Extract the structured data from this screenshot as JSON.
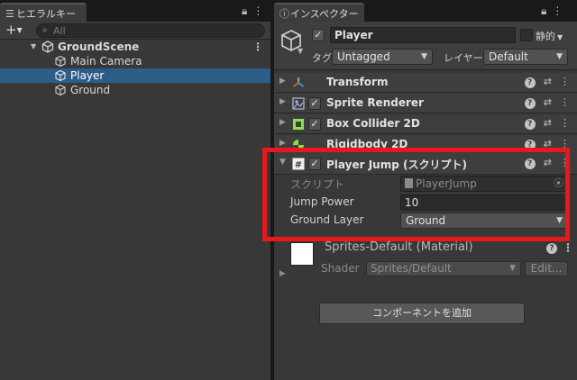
{
  "hierarchy": {
    "tab_label": "ヒエラルキー",
    "search_placeholder": "All",
    "add_button": "+",
    "scene_name": "GroundScene",
    "items": [
      {
        "label": "Main Camera"
      },
      {
        "label": "Player",
        "selected": true
      },
      {
        "label": "Ground"
      }
    ]
  },
  "inspector": {
    "tab_label": "インスペクター",
    "object_name": "Player",
    "active": true,
    "static_label": "静的",
    "tag_label": "タグ",
    "tag_value": "Untagged",
    "layer_label": "レイヤー",
    "layer_value": "Default",
    "components": [
      {
        "name": "Transform",
        "has_checkbox": false,
        "icon": "transform-icon"
      },
      {
        "name": "Sprite Renderer",
        "has_checkbox": true,
        "icon": "sprite-renderer-icon"
      },
      {
        "name": "Box Collider 2D",
        "has_checkbox": true,
        "icon": "box-collider-icon"
      },
      {
        "name": "Rigidbody 2D",
        "has_checkbox": false,
        "icon": "rigidbody-icon"
      },
      {
        "name": "Player Jump (スクリプト)",
        "has_checkbox": true,
        "icon": "script-icon"
      }
    ],
    "player_jump": {
      "script_label": "スクリプト",
      "script_value": "PlayerJump",
      "jump_power_label": "Jump Power",
      "jump_power_value": "10",
      "ground_layer_label": "Ground Layer",
      "ground_layer_value": "Ground"
    },
    "material": {
      "name": "Sprites-Default (Material)",
      "shader_label": "Shader",
      "shader_value": "Sprites/Default",
      "edit_label": "Edit..."
    },
    "add_component_label": "コンポーネントを追加"
  },
  "colors": {
    "selection": "#2c5d87",
    "highlight": "#e8181c",
    "panel": "#383838"
  }
}
